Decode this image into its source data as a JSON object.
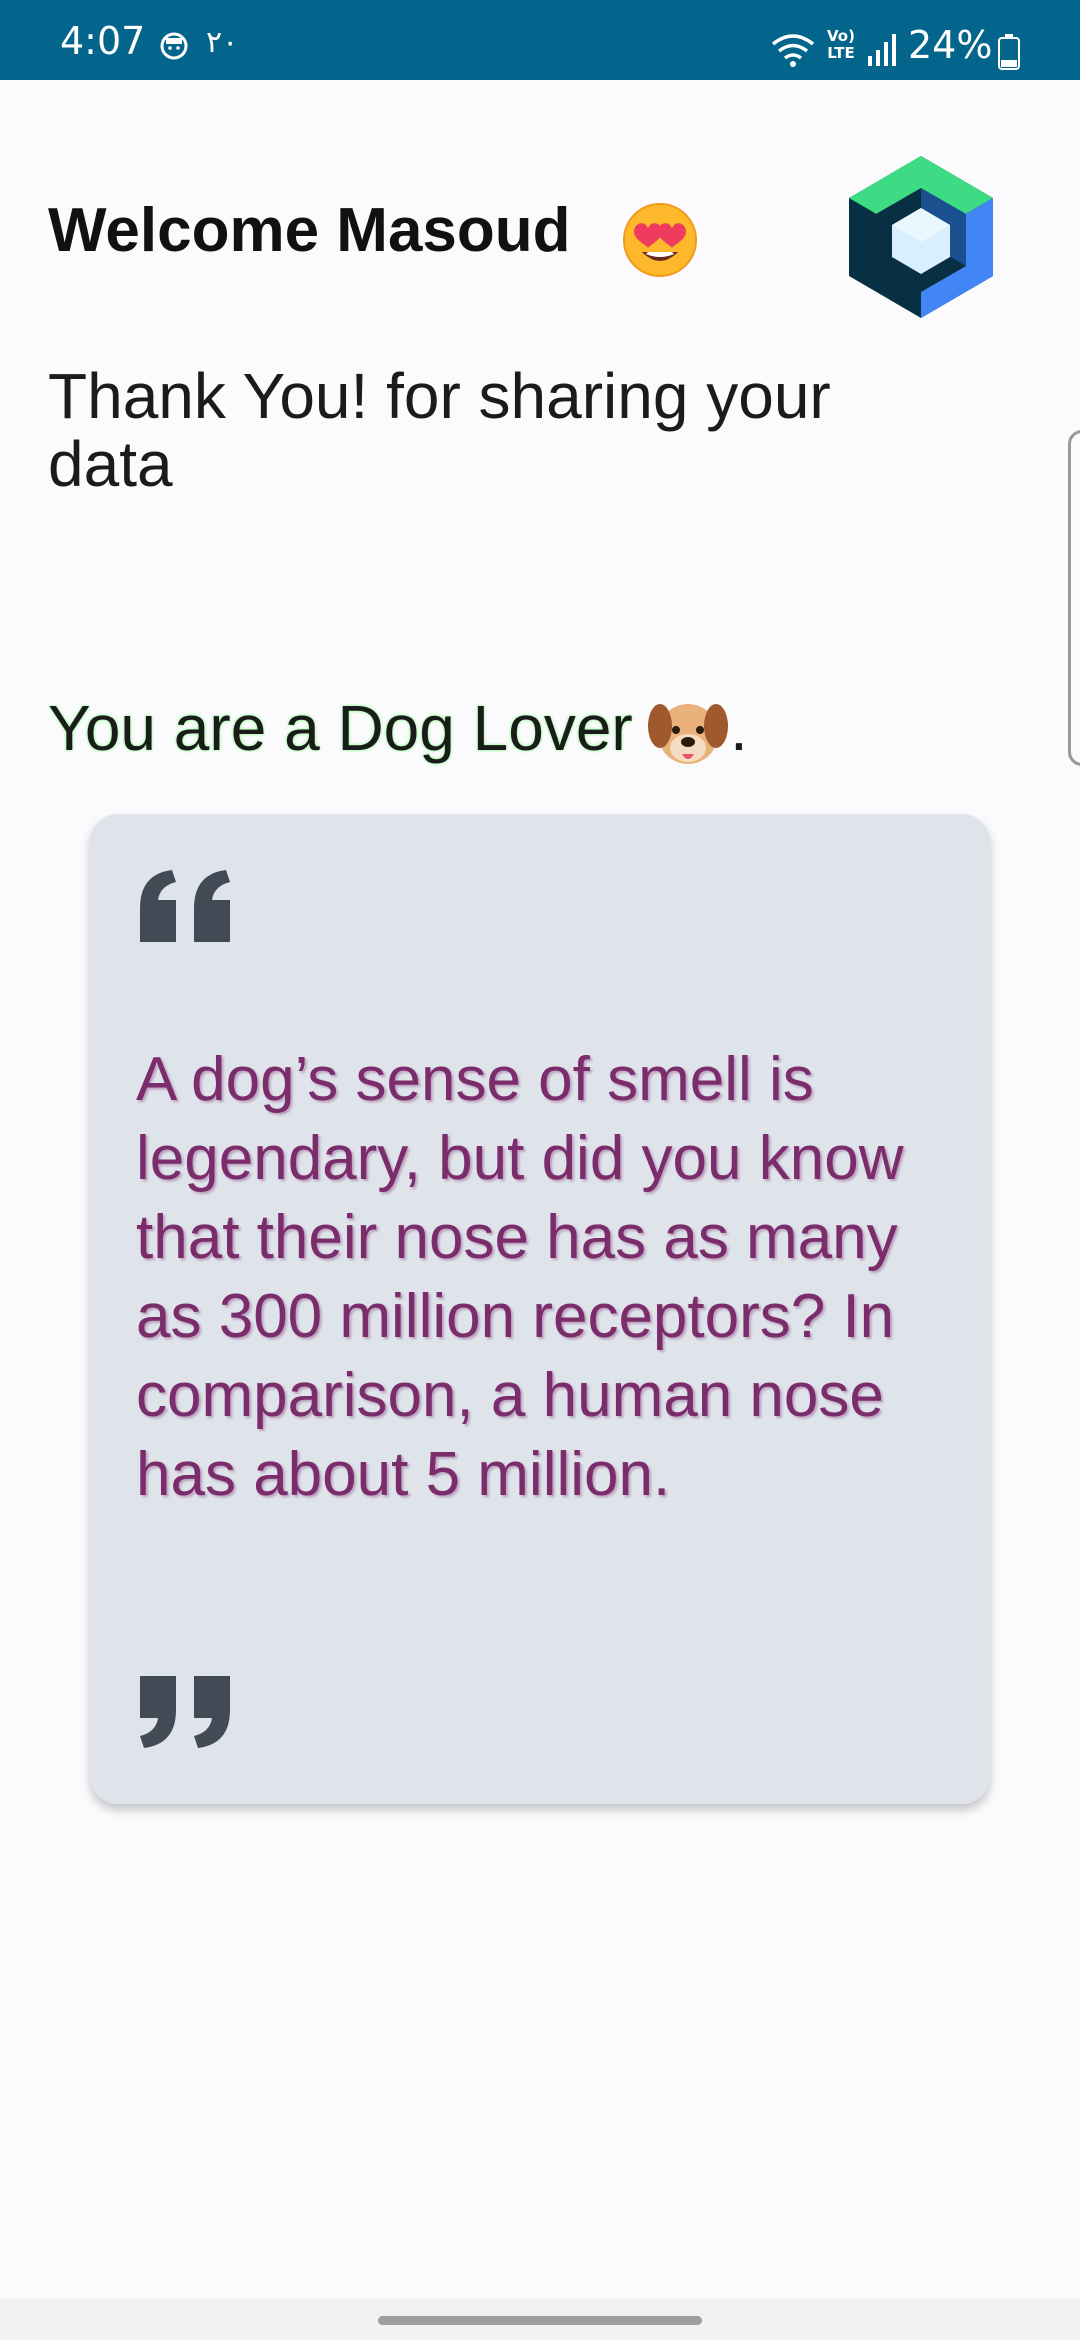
{
  "status_bar": {
    "time": "4:07",
    "extra": "٢٠",
    "volte": "Vo) LTE",
    "battery": "24%",
    "background": "#03658c"
  },
  "header": {
    "welcome": "Welcome Masoud",
    "welcome_emoji": "heart-eyes-emoji",
    "logo": "jetpack-compose-logo-icon"
  },
  "main": {
    "thanks": "Thank You! for sharing your data",
    "lover": "You are a Dog Lover",
    "lover_emoji": "dog-face-emoji",
    "lover_punct": "."
  },
  "quote_card": {
    "open_icon": "quote-open-icon",
    "text": "A dog’s sense of smell is legendary, but did you know that their nose has as many as 300 million receptors? In comparison, a human nose has about 5 million.",
    "close_icon": "quote-close-icon",
    "text_color": "#7a2c6b",
    "background": "#dfe3ea"
  }
}
